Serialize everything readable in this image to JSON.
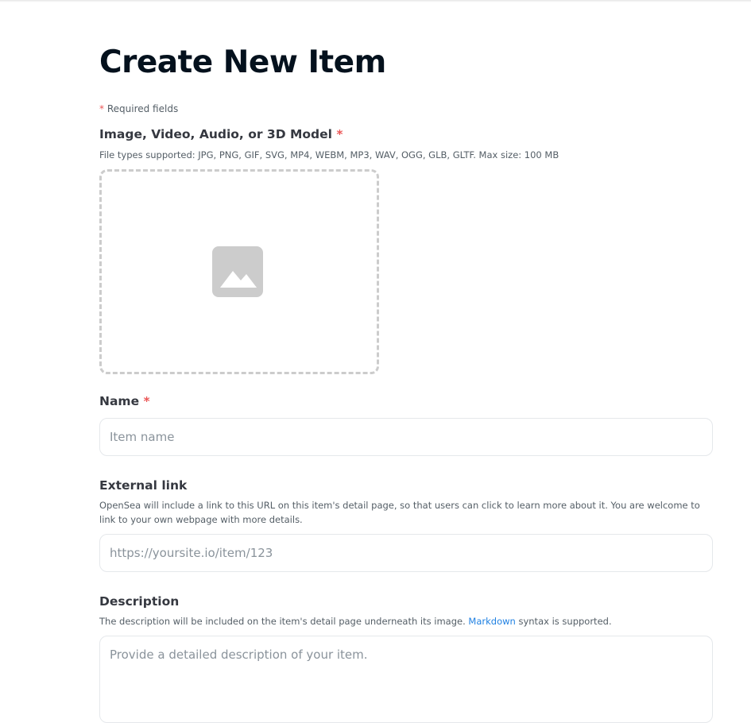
{
  "page": {
    "title": "Create New Item",
    "required_note_star": "*",
    "required_note": "Required fields"
  },
  "media": {
    "label": "Image, Video, Audio, or 3D Model",
    "required_star": "*",
    "hint": "File types supported: JPG, PNG, GIF, SVG, MP4, WEBM, MP3, WAV, OGG, GLB, GLTF. Max size: 100 MB",
    "dropzone_icon": "image-icon"
  },
  "name_field": {
    "label": "Name",
    "required_star": "*",
    "placeholder": "Item name",
    "value": ""
  },
  "external_link": {
    "label": "External link",
    "hint": "OpenSea will include a link to this URL on this item's detail page, so that users can click to learn more about it. You are welcome to link to your own webpage with more details.",
    "placeholder": "https://yoursite.io/item/123",
    "value": ""
  },
  "description": {
    "label": "Description",
    "hint_before": "The description will be included on the item's detail page underneath its image.",
    "hint_link": "Markdown",
    "hint_after": "syntax is supported.",
    "placeholder": "Provide a detailed description of your item.",
    "value": ""
  },
  "colors": {
    "accent_link": "#2081e2",
    "required_star": "#eb5757",
    "placeholder_icon": "#cccccc"
  }
}
